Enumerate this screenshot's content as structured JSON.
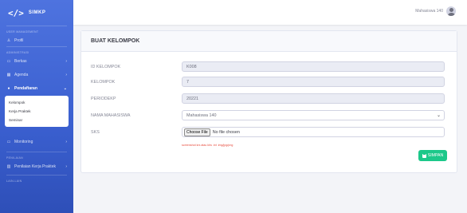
{
  "sidebar": {
    "brand": {
      "code": "</>",
      "name": "SIMKP"
    },
    "sections": {
      "user_management": "USER MANAGEMENT",
      "administrasi": "ADMINISTRASI",
      "penilaian": "PENILAIAN",
      "lain": "LAIN-LAIN"
    },
    "items": {
      "profil": "Profil",
      "berkas": "Berkas",
      "agenda": "Agenda",
      "pendaftaran": "Pendaftaran",
      "monitoring": "Monitoring",
      "penilaian_kp": "Penilaian Kerja Praktek"
    },
    "subitems": [
      "Kelompok",
      "Kerja Praktek",
      "Seminar"
    ]
  },
  "topbar": {
    "username": "Mahasiswa 140"
  },
  "form": {
    "title": "BUAT KELOMPOK",
    "id_label": "ID KELOMPOK",
    "id_value": "K008",
    "kelompok_label": "KELOMPOK",
    "kelompok_value": "7",
    "periode_label": "PERIODEKP",
    "periode_value": "20221",
    "mahasiswa_label": "NAMA MAHASISWA",
    "mahasiswa_value": "Mahasiswa 140",
    "sks_label": "SKS",
    "file_button": "Choose File",
    "file_status": "No file chosen",
    "hint": "screenshot krs atau khs .txt .img/jpg/png",
    "submit": "SIMPAN"
  },
  "colors": {
    "primary": "#4e73df",
    "success": "#1cc88a",
    "danger": "#e74a3b"
  }
}
